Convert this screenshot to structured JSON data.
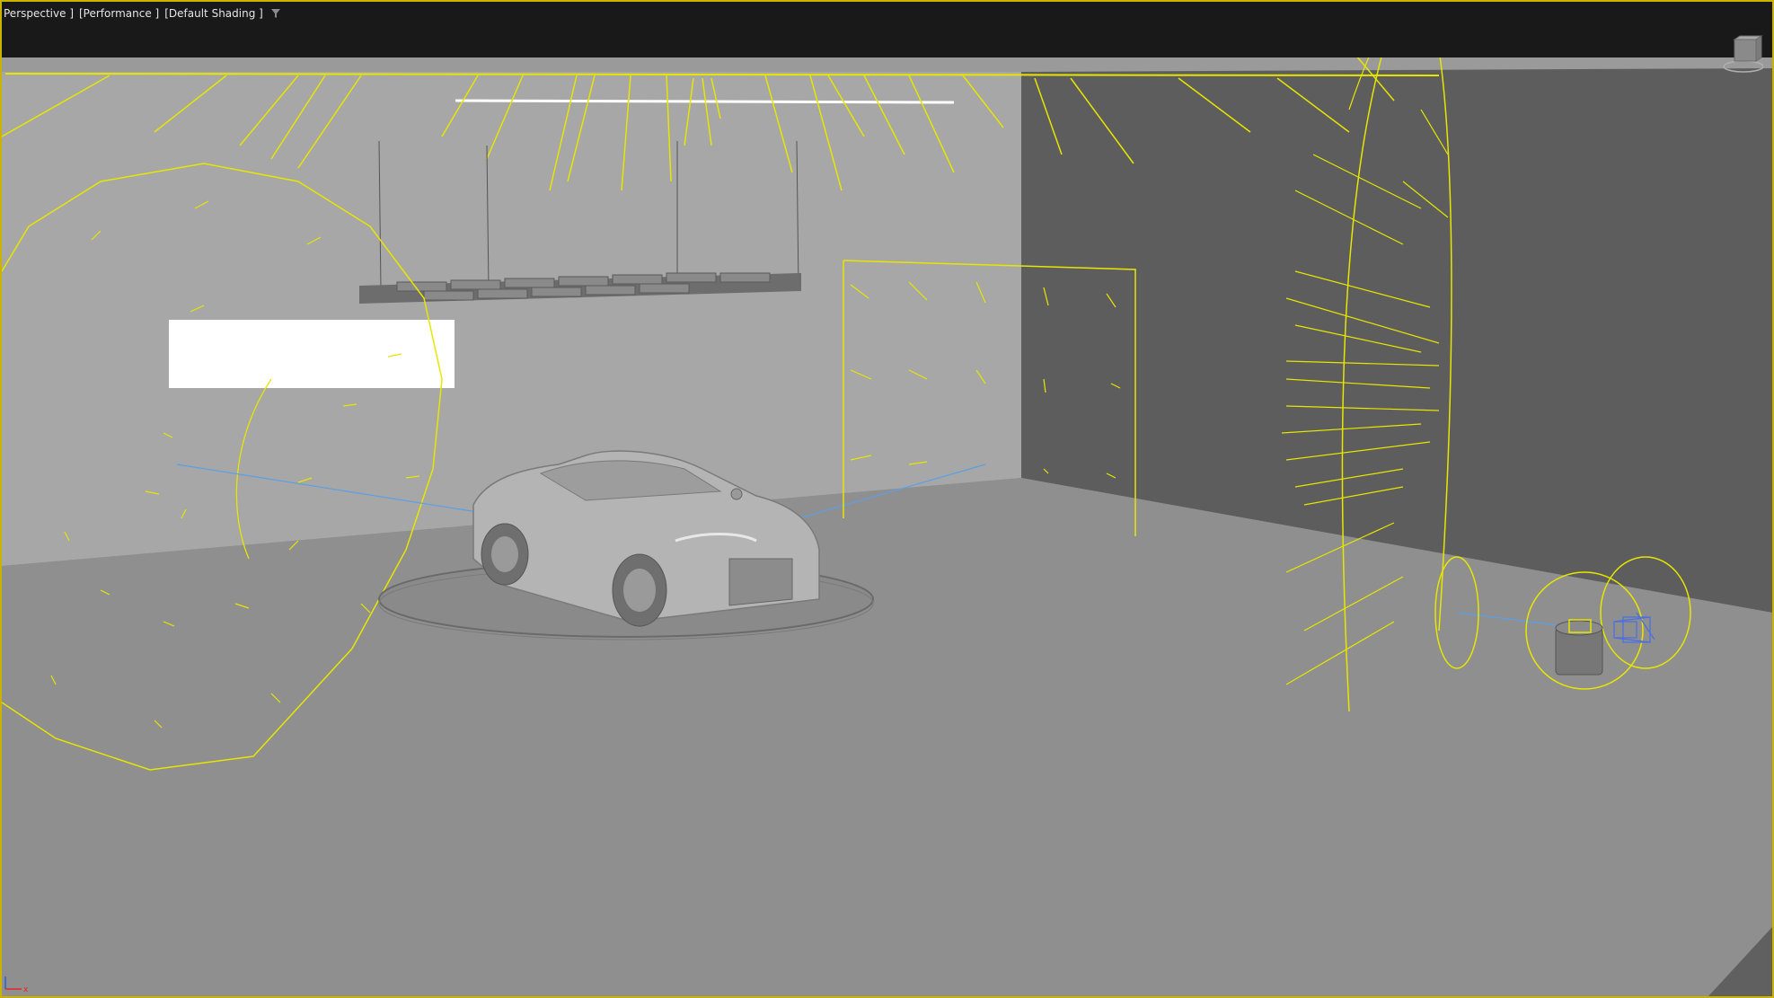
{
  "viewport": {
    "labels": {
      "view": "Perspective ]",
      "performance": "[Performance ]",
      "shading": "[Default Shading ]"
    },
    "filter_icon": "filter-icon",
    "viewcube_icon": "viewcube-icon",
    "axis_icon": "axis-tripod-icon"
  },
  "colors": {
    "active_border": "#c9b300",
    "light_gizmo": "#e6e600",
    "target_line": "#5aa0e6",
    "topbar": "#191919"
  }
}
